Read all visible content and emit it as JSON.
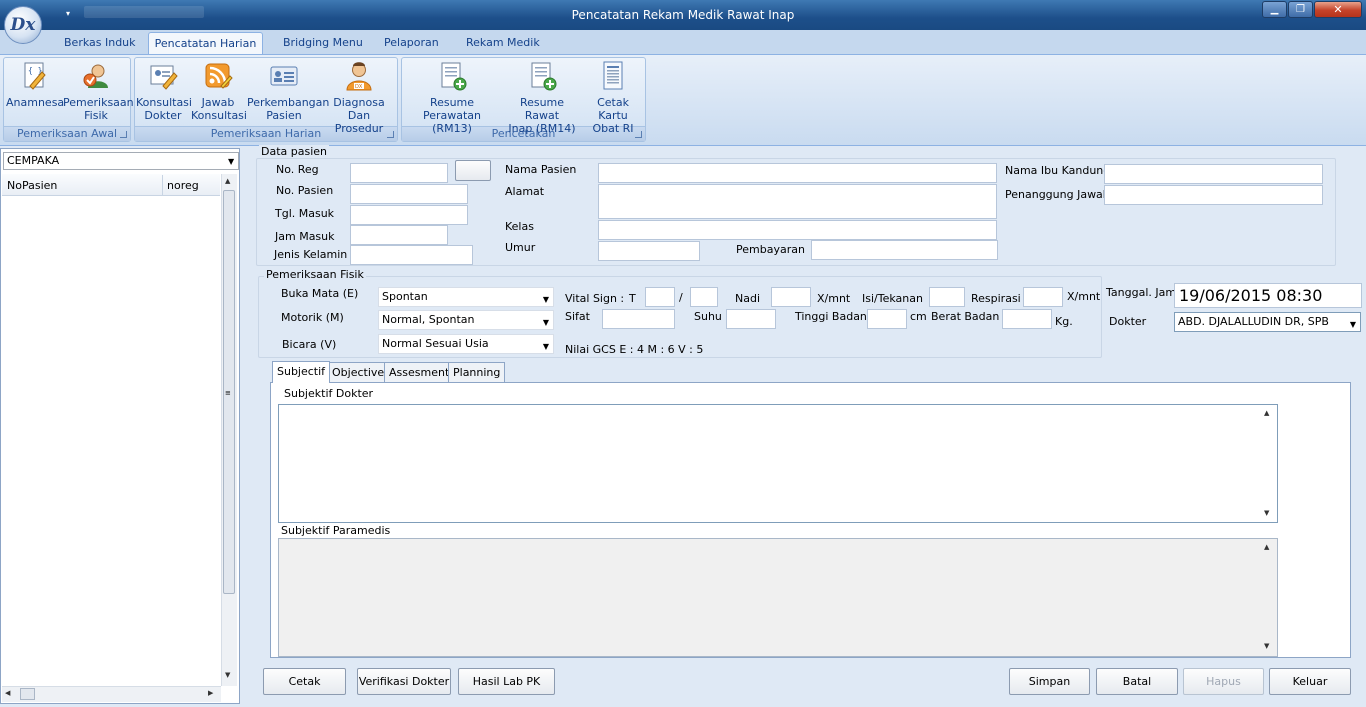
{
  "window": {
    "title": "Pencatatan Rekam Medik Rawat Inap",
    "app_icon": "Dx",
    "buttons": {
      "minimize": "▁",
      "maximize": "❐",
      "close": "✕"
    },
    "qat_arrow": "▾"
  },
  "ribbon": {
    "tabs": [
      "Berkas Induk",
      "Pencatatan Harian",
      "Bridging Menu",
      "Pelaporan",
      "Rekam Medik"
    ],
    "active_tab": "Pencatatan Harian",
    "groups": [
      {
        "label": "Pemeriksaan Awal",
        "buttons": [
          {
            "line1": "Anamnesa",
            "line2": "",
            "icon": "document-edit-icon"
          },
          {
            "line1": "Pemeriksaan",
            "line2": "Fisik",
            "icon": "user-check-icon"
          }
        ]
      },
      {
        "label": "Pemeriksaan Harian",
        "buttons": [
          {
            "line1": "Konsultasi",
            "line2": "Dokter",
            "icon": "consult-icon"
          },
          {
            "line1": "Jawab",
            "line2": "Konsultasi",
            "icon": "rss-icon"
          },
          {
            "line1": "Perkembangan",
            "line2": "Pasien",
            "icon": "patient-card-icon"
          },
          {
            "line1": "Diagnosa Dan",
            "line2": "Prosedur",
            "icon": "doctor-icon"
          }
        ]
      },
      {
        "label": "Pencetakan",
        "buttons": [
          {
            "line1": "Resume Perawatan",
            "line2": "(RM13)",
            "icon": "document-add-icon"
          },
          {
            "line1": "Resume Rawat",
            "line2": "Inap (RM14)",
            "icon": "document-add-icon"
          },
          {
            "line1": "Cetak Kartu",
            "line2": "Obat RI",
            "icon": "document-lines-icon"
          }
        ]
      }
    ]
  },
  "left": {
    "ward": "CEMPAKA",
    "columns": [
      "NoPasien",
      "noreg"
    ]
  },
  "data_pasien": {
    "section": "Data pasien",
    "no_reg": "No. Reg",
    "no_pasien": "No. Pasien",
    "tgl_masuk": "Tgl. Masuk",
    "jam_masuk": "Jam Masuk",
    "jenis_kelamin": "Jenis Kelamin",
    "nama_pasien": "Nama Pasien",
    "alamat": "Alamat",
    "kelas": "Kelas",
    "umur": "Umur",
    "pembayaran": "Pembayaran",
    "nama_ibu": "Nama Ibu Kandung",
    "penanggung": "Penanggung Jawab"
  },
  "fisik": {
    "section": "Pemeriksaan Fisik",
    "buka_mata": "Buka Mata (E)",
    "buka_mata_val": "Spontan",
    "motorik": "Motorik (M)",
    "motorik_val": "Normal, Spontan",
    "bicara": "Bicara (V)",
    "bicara_val": "Normal Sesuai Usia",
    "vital_sign": "Vital Sign  :",
    "t": "T",
    "slash": "/",
    "nadi": "Nadi",
    "x_mnt": "X/mnt",
    "isi_tekanan": "Isi/Tekanan",
    "respirasi": "Respirasi",
    "x_mnt2": "X/mnt",
    "sifat": "Sifat",
    "suhu": "Suhu",
    "tinggi": "Tinggi Badan",
    "cm": "cm",
    "berat": "Berat Badan",
    "kg": "Kg.",
    "gcs": "Nilai GCS   E : 4    M : 6    V : 5"
  },
  "right": {
    "tanggal_label": "Tanggal. Jam",
    "tanggal_value": "19/06/2015 08:30",
    "dokter_label": "Dokter",
    "dokter_value": "ABD. DJALALLUDIN DR, SPB"
  },
  "soap": {
    "tabs": [
      "Subjectif",
      "Objective",
      "Assesment",
      "Planning"
    ],
    "subjektif_dokter": "Subjektif Dokter",
    "subjektif_paramedis": "Subjektif Paramedis"
  },
  "footer": {
    "cetak": "Cetak",
    "verifikasi": "Verifikasi Dokter",
    "hasil_lab": "Hasil Lab PK",
    "simpan": "Simpan",
    "batal": "Batal",
    "hapus": "Hapus",
    "keluar": "Keluar"
  },
  "colors": {
    "accent": "#15428b",
    "titlebar": "#1d4f8a"
  }
}
